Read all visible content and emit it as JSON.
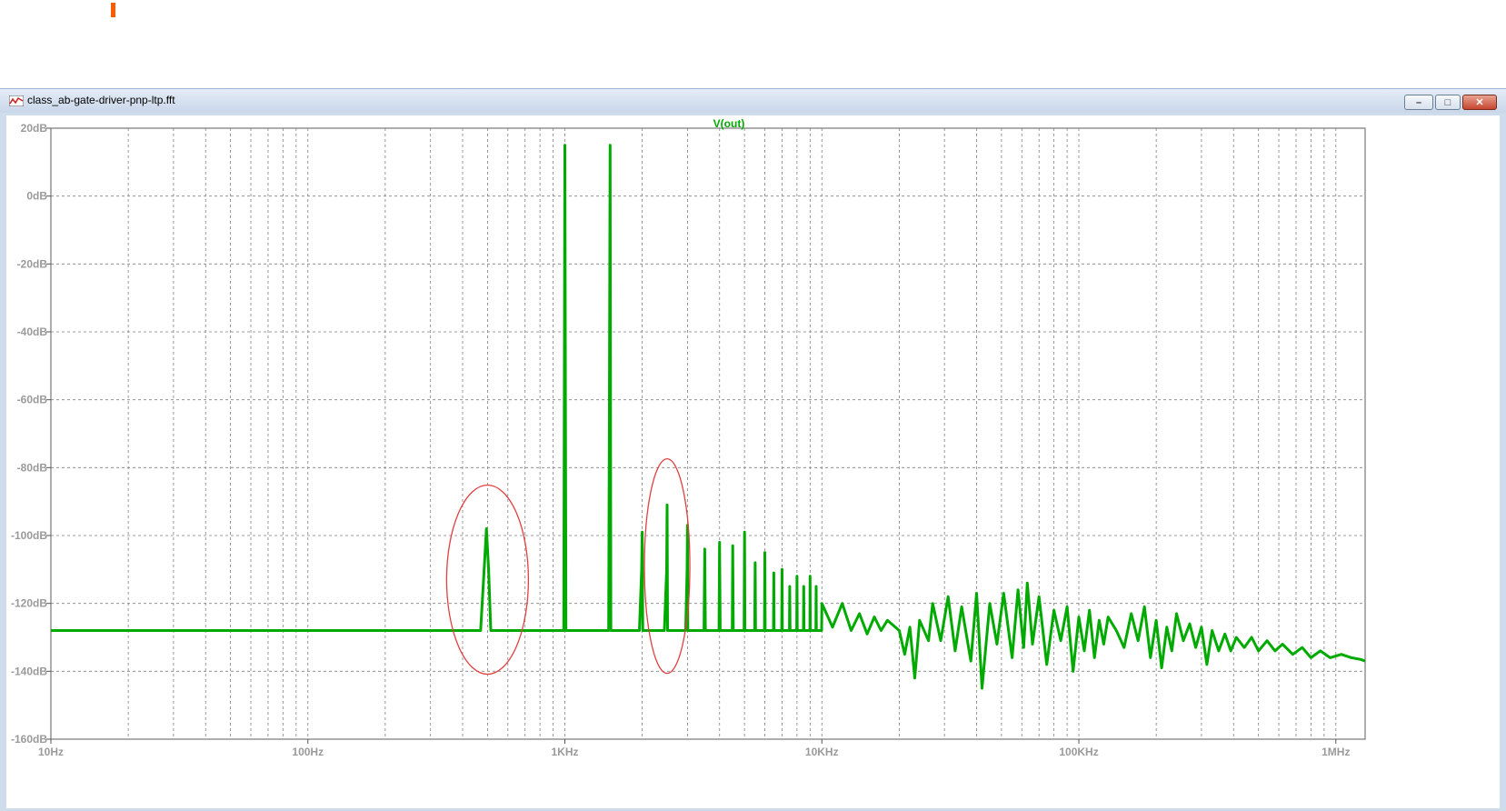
{
  "window": {
    "title": "class_ab-gate-driver-pnp-ltp.fft",
    "minimize_label": "–",
    "maximize_label": "□",
    "close_label": "✕"
  },
  "icons": [
    "waveform-icon"
  ],
  "colors": {
    "trace": "#00aa00",
    "annotation": "#e04040",
    "grid": "#808080",
    "marker": "#ff5a00"
  },
  "chart_data": {
    "type": "line",
    "title": "V(out)",
    "xscale": "log",
    "xlim": [
      10,
      1300000
    ],
    "ylim": [
      -160,
      20
    ],
    "grid": true,
    "x_ticks": [
      {
        "value": 10,
        "label": "10Hz"
      },
      {
        "value": 100,
        "label": "100Hz"
      },
      {
        "value": 1000,
        "label": "1KHz"
      },
      {
        "value": 10000,
        "label": "10KHz"
      },
      {
        "value": 100000,
        "label": "100KHz"
      },
      {
        "value": 1000000,
        "label": "1MHz"
      }
    ],
    "y_ticks": [
      {
        "value": 20,
        "label": "20dB"
      },
      {
        "value": 0,
        "label": "0dB"
      },
      {
        "value": -20,
        "label": "-20dB"
      },
      {
        "value": -40,
        "label": "-40dB"
      },
      {
        "value": -60,
        "label": "-60dB"
      },
      {
        "value": -80,
        "label": "-80dB"
      },
      {
        "value": -100,
        "label": "-100dB"
      },
      {
        "value": -120,
        "label": "-120dB"
      },
      {
        "value": -140,
        "label": "-140dB"
      },
      {
        "value": -160,
        "label": "-160dB"
      }
    ],
    "series": [
      {
        "name": "V(out)",
        "points": [
          [
            10,
            -128
          ],
          [
            60,
            -128
          ],
          [
            200,
            -128
          ],
          [
            440,
            -128
          ],
          [
            470,
            -128
          ],
          [
            485,
            -110
          ],
          [
            495,
            -98
          ],
          [
            505,
            -110
          ],
          [
            515,
            -128
          ],
          [
            900,
            -128
          ],
          [
            990,
            -128
          ],
          [
            1000,
            15
          ],
          [
            1010,
            -128
          ],
          [
            1480,
            -128
          ],
          [
            1490,
            -60
          ],
          [
            1500,
            15
          ],
          [
            1510,
            -128
          ],
          [
            1950,
            -128
          ],
          [
            1990,
            -110
          ],
          [
            2000,
            -99
          ],
          [
            2010,
            -128
          ],
          [
            2440,
            -128
          ],
          [
            2490,
            -110
          ],
          [
            2500,
            -91
          ],
          [
            2510,
            -128
          ],
          [
            2950,
            -128
          ],
          [
            2990,
            -110
          ],
          [
            3000,
            -97
          ],
          [
            3010,
            -128
          ],
          [
            3480,
            -128
          ],
          [
            3500,
            -104
          ],
          [
            3520,
            -128
          ],
          [
            3980,
            -128
          ],
          [
            4000,
            -102
          ],
          [
            4020,
            -128
          ],
          [
            4480,
            -128
          ],
          [
            4500,
            -103
          ],
          [
            4520,
            -128
          ],
          [
            4980,
            -128
          ],
          [
            5000,
            -99
          ],
          [
            5020,
            -128
          ],
          [
            5480,
            -128
          ],
          [
            5500,
            -108
          ],
          [
            5520,
            -128
          ],
          [
            5980,
            -128
          ],
          [
            6000,
            -105
          ],
          [
            6020,
            -128
          ],
          [
            6480,
            -128
          ],
          [
            6500,
            -111
          ],
          [
            6520,
            -128
          ],
          [
            6980,
            -128
          ],
          [
            7000,
            -110
          ],
          [
            7020,
            -128
          ],
          [
            7480,
            -128
          ],
          [
            7500,
            -115
          ],
          [
            7520,
            -128
          ],
          [
            7980,
            -128
          ],
          [
            8000,
            -112
          ],
          [
            8020,
            -128
          ],
          [
            8480,
            -128
          ],
          [
            8500,
            -115
          ],
          [
            8520,
            -128
          ],
          [
            8980,
            -128
          ],
          [
            9000,
            -112
          ],
          [
            9020,
            -128
          ],
          [
            9480,
            -128
          ],
          [
            9500,
            -115
          ],
          [
            9520,
            -128
          ],
          [
            9980,
            -128
          ],
          [
            10000,
            -120
          ],
          [
            11000,
            -127
          ],
          [
            12000,
            -120
          ],
          [
            13000,
            -128
          ],
          [
            14000,
            -123
          ],
          [
            15000,
            -129
          ],
          [
            16000,
            -124
          ],
          [
            17000,
            -128
          ],
          [
            18000,
            -125
          ],
          [
            20000,
            -128
          ],
          [
            21000,
            -135
          ],
          [
            22000,
            -127
          ],
          [
            23000,
            -142
          ],
          [
            24000,
            -125
          ],
          [
            26000,
            -131
          ],
          [
            27000,
            -120
          ],
          [
            29000,
            -131
          ],
          [
            31000,
            -118
          ],
          [
            33000,
            -134
          ],
          [
            35000,
            -121
          ],
          [
            38000,
            -137
          ],
          [
            40000,
            -117
          ],
          [
            42000,
            -145
          ],
          [
            45000,
            -120
          ],
          [
            48000,
            -132
          ],
          [
            51000,
            -117
          ],
          [
            55000,
            -136
          ],
          [
            58000,
            -116
          ],
          [
            61000,
            -133
          ],
          [
            63000,
            -114
          ],
          [
            66000,
            -132
          ],
          [
            70000,
            -118
          ],
          [
            75000,
            -138
          ],
          [
            80000,
            -122
          ],
          [
            85000,
            -131
          ],
          [
            90000,
            -121
          ],
          [
            95000,
            -140
          ],
          [
            100000,
            -124
          ],
          [
            105000,
            -134
          ],
          [
            110000,
            -122
          ],
          [
            115000,
            -136
          ],
          [
            120000,
            -125
          ],
          [
            125000,
            -132
          ],
          [
            130000,
            -124
          ],
          [
            140000,
            -128
          ],
          [
            150000,
            -133
          ],
          [
            160000,
            -123
          ],
          [
            170000,
            -131
          ],
          [
            180000,
            -121
          ],
          [
            190000,
            -136
          ],
          [
            200000,
            -125
          ],
          [
            210000,
            -139
          ],
          [
            220000,
            -127
          ],
          [
            230000,
            -134
          ],
          [
            240000,
            -123
          ],
          [
            255000,
            -131
          ],
          [
            270000,
            -126
          ],
          [
            285000,
            -133
          ],
          [
            300000,
            -127
          ],
          [
            315000,
            -138
          ],
          [
            330000,
            -128
          ],
          [
            350000,
            -134
          ],
          [
            370000,
            -129
          ],
          [
            390000,
            -134
          ],
          [
            410000,
            -130
          ],
          [
            440000,
            -133
          ],
          [
            470000,
            -130
          ],
          [
            500000,
            -134
          ],
          [
            540000,
            -131
          ],
          [
            580000,
            -134
          ],
          [
            620000,
            -132
          ],
          [
            680000,
            -135
          ],
          [
            740000,
            -133
          ],
          [
            800000,
            -136
          ],
          [
            870000,
            -134
          ],
          [
            950000,
            -136
          ],
          [
            1050000,
            -135
          ],
          [
            1150000,
            -136
          ],
          [
            1250000,
            -136.5
          ],
          [
            1300000,
            -137
          ]
        ]
      }
    ],
    "annotations": [
      {
        "shape": "ellipse",
        "cx_freq": 500,
        "cy_db": -113
      },
      {
        "shape": "ellipse",
        "cx_freq": 2500,
        "cy_db": -109
      }
    ]
  }
}
